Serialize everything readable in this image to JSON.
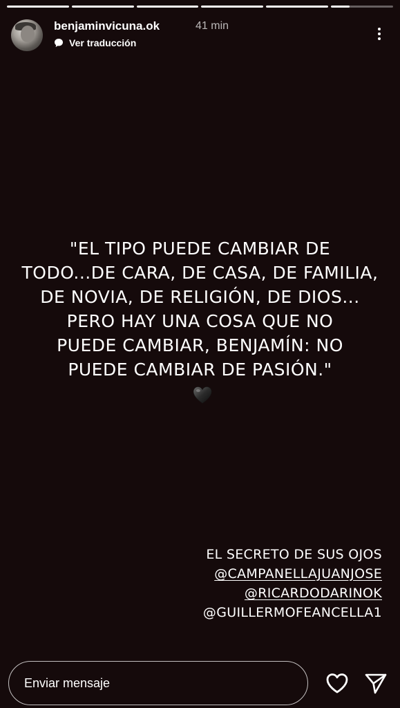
{
  "progress": {
    "segments": [
      1,
      1,
      1,
      1,
      1,
      0.3
    ]
  },
  "header": {
    "username": "benjaminvicuna.ok",
    "time": "41 min",
    "translate_label": "Ver traducción"
  },
  "story": {
    "background": "#150a0b",
    "quote": "\"EL TIPO PUEDE CAMBIAR DE\nTODO...DE CARA, DE CASA, DE FAMILIA,\nDE NOVIA, DE RELIGIÓN, DE DIOS...\nPERO HAY UNA COSA QUE NO\nPUEDE CAMBIAR, BENJAMÍN: NO\nPUEDE CAMBIAR DE PASIÓN.\"",
    "heart_icon": "black-heart-icon",
    "credits": {
      "title": "EL SECRETO DE SUS OJOS",
      "mentions": [
        "@CAMPANELLAJUANJOSE",
        "@RICARDODARINOK"
      ],
      "last_line": "@GUILLERMOFEANCELLA1"
    }
  },
  "footer": {
    "message_placeholder": "Enviar mensaje",
    "like_icon": "heart-outline-icon",
    "send_icon": "send-icon"
  }
}
